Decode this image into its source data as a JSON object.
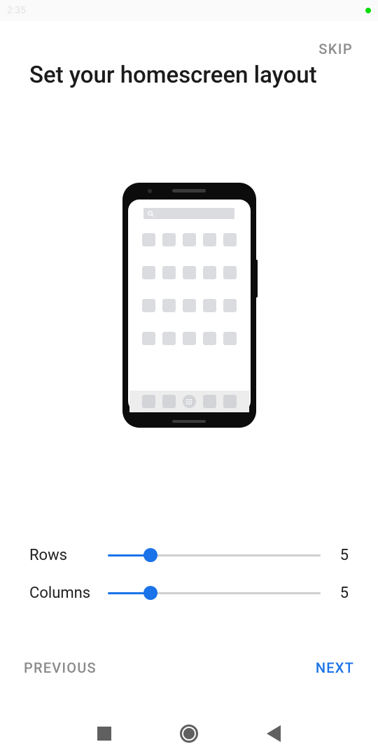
{
  "status_bar": {
    "time": "2:35"
  },
  "header": {
    "skip_label": "SKIP",
    "title": "Set your homescreen layout"
  },
  "sliders": {
    "rows": {
      "label": "Rows",
      "value": "5"
    },
    "columns": {
      "label": "Columns",
      "value": "5"
    }
  },
  "footer": {
    "previous_label": "PREVIOUS",
    "next_label": "NEXT"
  }
}
